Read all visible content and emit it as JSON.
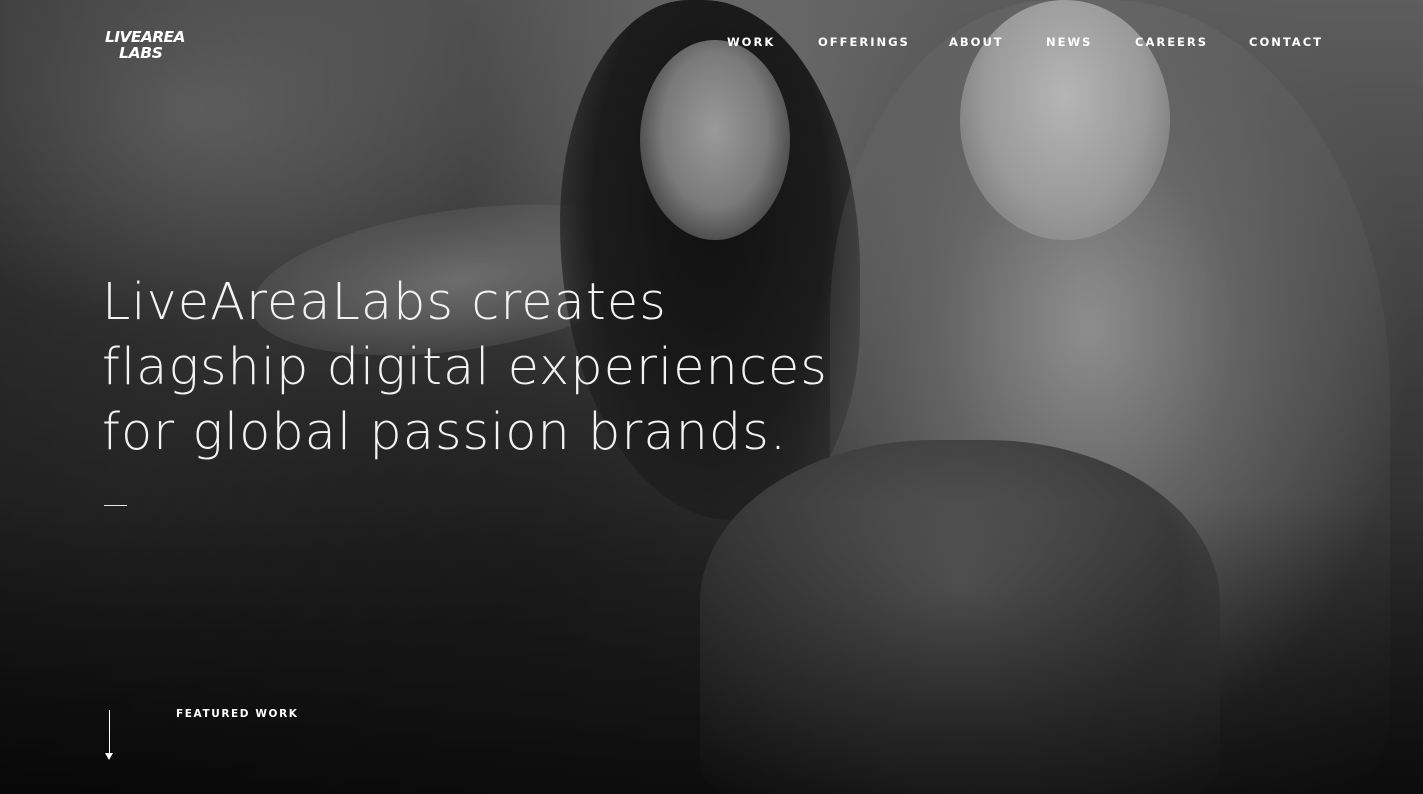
{
  "brand": {
    "logo_line1": "LIVEAREA",
    "logo_line2": "LABS",
    "logo_alt": "LiveAreaLabs"
  },
  "nav": {
    "items": [
      {
        "label": "WORK"
      },
      {
        "label": "OFFERINGS"
      },
      {
        "label": "ABOUT"
      },
      {
        "label": "NEWS"
      },
      {
        "label": "CAREERS"
      },
      {
        "label": "CONTACT"
      }
    ]
  },
  "hero": {
    "headline_lines": [
      "LiveAreaLabs creates",
      "flagship digital experiences",
      "for global passion brands."
    ],
    "featured_label": "FEATURED WORK"
  },
  "icons": {
    "scroll": "down-arrow-icon"
  },
  "colors": {
    "text": "#ffffff",
    "background": "#3d3d3d"
  }
}
